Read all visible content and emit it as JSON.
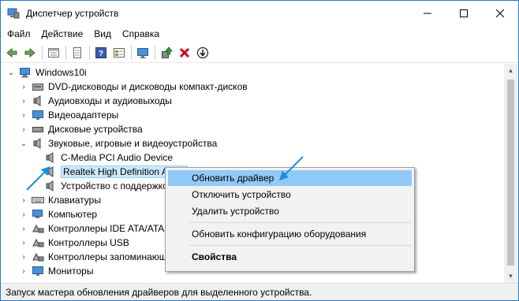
{
  "window": {
    "title": "Диспетчер устройств",
    "icon": "device-manager-icon",
    "controls": [
      "minimize",
      "maximize",
      "close"
    ]
  },
  "menu": [
    "Файл",
    "Действие",
    "Вид",
    "Справка"
  ],
  "toolbar": {
    "buttons": [
      "back-icon",
      "forward-icon",
      "properties-view-icon",
      "document-icon",
      "help-icon",
      "view-icon",
      "monitor-icon",
      "update-driver-icon",
      "uninstall-icon",
      "disable-icon"
    ]
  },
  "tree": {
    "root": "Windows10i",
    "items": [
      {
        "label": "DVD-дисководы и дисководы компакт-дисков",
        "icon": "dvd-icon"
      },
      {
        "label": "Аудиовходы и аудиовыходы",
        "icon": "speaker-icon"
      },
      {
        "label": "Видеоадаптеры",
        "icon": "display-adapter-icon"
      },
      {
        "label": "Дисковые устройства",
        "icon": "disk-icon"
      },
      {
        "label": "Звуковые, игровые и видеоустройства",
        "icon": "speaker-icon",
        "expanded": true,
        "children": [
          {
            "label": "C-Media PCI Audio Device",
            "icon": "speaker-icon"
          },
          {
            "label": "Realtek High Definition Audio",
            "icon": "speaker-icon",
            "selected": true
          },
          {
            "label": "Устройство с поддержкой High Definition Audio",
            "icon": "speaker-icon"
          }
        ]
      },
      {
        "label": "Клавиатуры",
        "icon": "keyboard-icon"
      },
      {
        "label": "Компьютер",
        "icon": "computer-icon"
      },
      {
        "label": "Контроллеры IDE ATA/ATAPI",
        "icon": "ide-controller-icon"
      },
      {
        "label": "Контроллеры USB",
        "icon": "usb-icon"
      },
      {
        "label": "Контроллеры запоминающих устройств",
        "icon": "storage-icon"
      },
      {
        "label": "Мониторы",
        "icon": "monitor-icon"
      }
    ]
  },
  "context_menu": {
    "items": [
      {
        "label": "Обновить драйвер",
        "highlighted": true
      },
      {
        "label": "Отключить устройство"
      },
      {
        "label": "Удалить устройство"
      },
      {
        "separator": true
      },
      {
        "label": "Обновить конфигурацию оборудования"
      },
      {
        "separator": true
      },
      {
        "label": "Свойства",
        "bold": true
      }
    ]
  },
  "statusbar": {
    "text": "Запуск мастера обновления драйверов для выделенного устройства."
  },
  "colors": {
    "selection": "#cce8ff",
    "menu_highlight": "#91c9f7",
    "annotation_arrow": "#1a8fd8",
    "delete_red": "#d0021b"
  }
}
